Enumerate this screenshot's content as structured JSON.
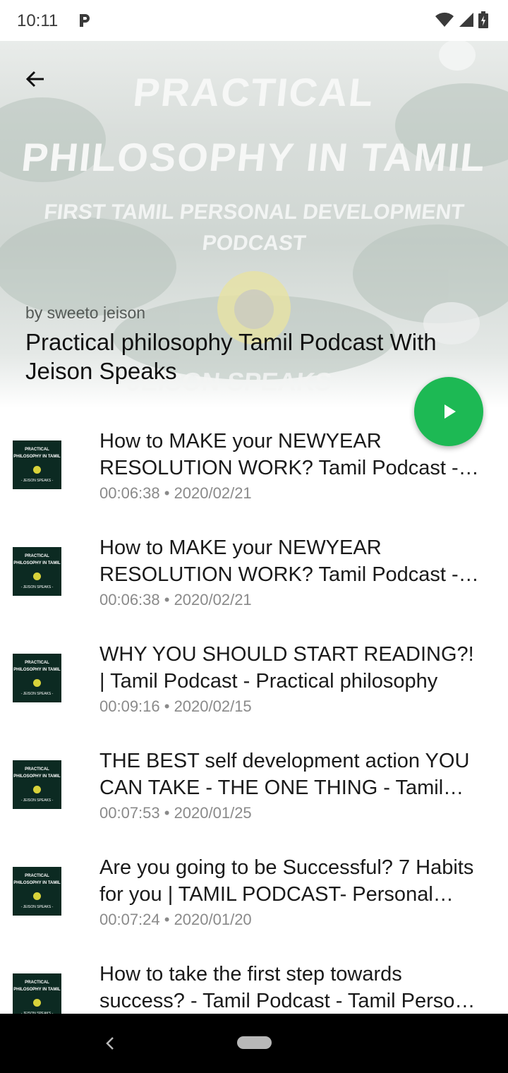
{
  "status_bar": {
    "time": "10:11"
  },
  "header": {
    "artwork": {
      "line1": "PRACTICAL",
      "line2": "PHILOSOPHY IN TAMIL",
      "sub1": "FIRST TAMIL PERSONAL DEVELOPMENT",
      "sub2": "PODCAST",
      "bottom": "JEISON SPEAKS -"
    },
    "byline": "by sweeto jeison",
    "title": "Practical philosophy Tamil Podcast With Jeison Speaks"
  },
  "thumbnail": {
    "line1": "PRACTICAL",
    "line2": "PHILOSOPHY IN TAMIL",
    "bottom": "- JEISON SPEAKS -"
  },
  "episodes": [
    {
      "title": "How to MAKE your NEWYEAR RESOLUTION WORK? Tamil Podcast - Practical philosophy",
      "meta": "00:06:38 • 2020/02/21"
    },
    {
      "title": "How to MAKE your NEWYEAR RESOLUTION WORK? Tamil Podcast - Practical philosophy",
      "meta": "00:06:38 • 2020/02/21"
    },
    {
      "title": "WHY YOU SHOULD START READING?! | Tamil Podcast - Practical philosophy",
      "meta": "00:09:16 • 2020/02/15"
    },
    {
      "title": "THE BEST self development action YOU CAN TAKE - THE ONE THING - Tamil Podcast",
      "meta": "00:07:53 • 2020/01/25"
    },
    {
      "title": "Are you going to be Successful? 7 Habits for you | TAMIL PODCAST- Personal development",
      "meta": "00:07:24 • 2020/01/20"
    },
    {
      "title": "How to take the first step towards success? - Tamil Podcast - Tamil Personal development",
      "meta": ""
    }
  ],
  "colors": {
    "accent": "#1db954",
    "thumb_bg": "#0c2a22"
  }
}
